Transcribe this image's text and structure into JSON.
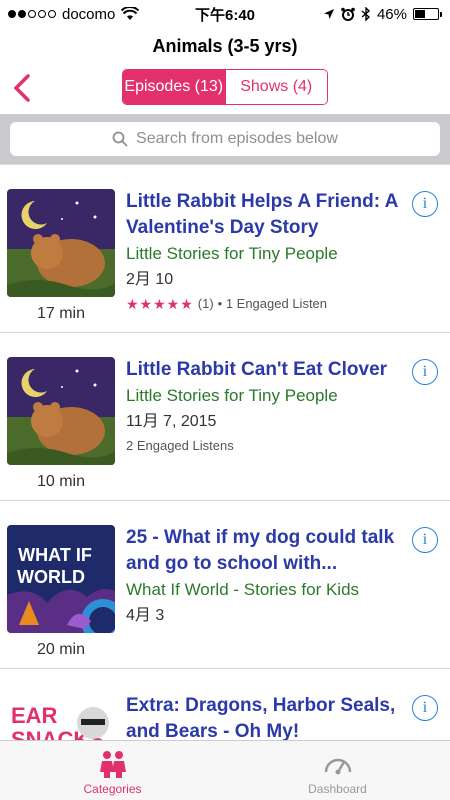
{
  "status_bar": {
    "carrier": "docomo",
    "time": "下午6:40",
    "battery_percent": "46%",
    "battery_level": 0.46,
    "signal_bars": 2,
    "signal_total": 5
  },
  "nav": {
    "title": "Animals (3-5 yrs)",
    "segments": [
      {
        "label": "Episodes (13)",
        "active": true
      },
      {
        "label": "Shows (4)",
        "active": false
      }
    ]
  },
  "search": {
    "placeholder": "Search from episodes below"
  },
  "episodes": [
    {
      "title": "Little Rabbit Helps A Friend: A Valentine's Day Story",
      "show": "Little Stories for Tiny People",
      "date": "2月 10",
      "rating_count": "(1)",
      "meta": "• 1 Engaged Listen",
      "duration": "17 min",
      "stars": 5
    },
    {
      "title": "Little Rabbit Can't Eat Clover",
      "show": "Little Stories for Tiny People",
      "date": "11月 7, 2015",
      "meta": "2 Engaged Listens",
      "duration": "10 min"
    },
    {
      "title": "25 - What if my dog could talk and go to school with...",
      "show": "What If World - Stories for Kids",
      "date": "4月 3",
      "duration": "20 min",
      "art_text_line1": "WHAT IF",
      "art_text_line2": "WORLD"
    },
    {
      "title": "Extra: Dragons, Harbor Seals, and Bears - Oh My!",
      "art_text_line1": "EAR",
      "art_text_line2": "SNACKS"
    }
  ],
  "tabs": [
    {
      "label": "Categories",
      "active": true
    },
    {
      "label": "Dashboard",
      "active": false
    }
  ],
  "colors": {
    "accent": "#e2306c",
    "title_blue": "#2b3aa8",
    "show_green": "#2a7a2a",
    "info_blue": "#2b7fe0"
  }
}
